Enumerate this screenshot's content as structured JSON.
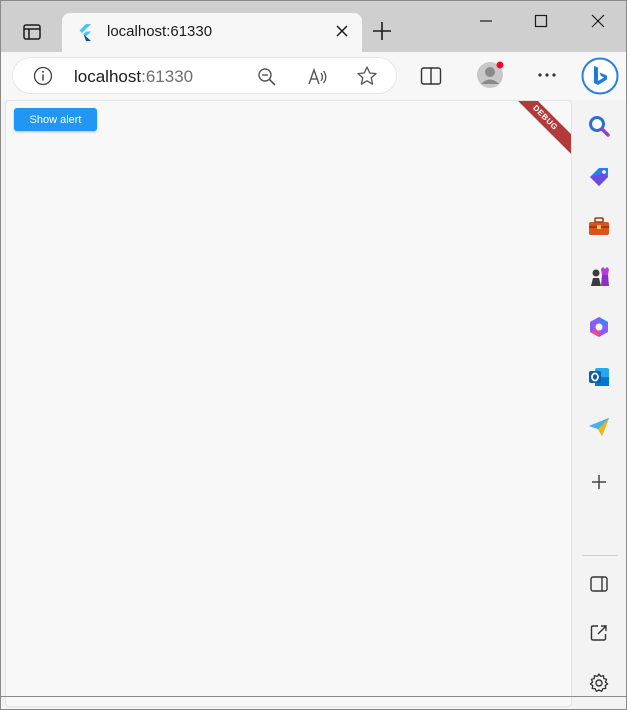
{
  "window": {
    "tab_title": "localhost:61330"
  },
  "address_bar": {
    "host": "localhost",
    "port": ":61330"
  },
  "page": {
    "show_alert_label": "Show alert",
    "debug_banner": "DEBUG"
  },
  "colors": {
    "button": "#2196f3",
    "debug_banner": "#b13a3a",
    "profile_badge": "#e81123"
  },
  "sidebar": {
    "items": [
      "search-icon",
      "shopping-tag-icon",
      "tools-icon",
      "games-icon",
      "office-icon",
      "outlook-icon",
      "send-icon",
      "add-icon"
    ],
    "bottom_items": [
      "sidebar-toggle-icon",
      "open-external-icon",
      "settings-icon"
    ]
  }
}
